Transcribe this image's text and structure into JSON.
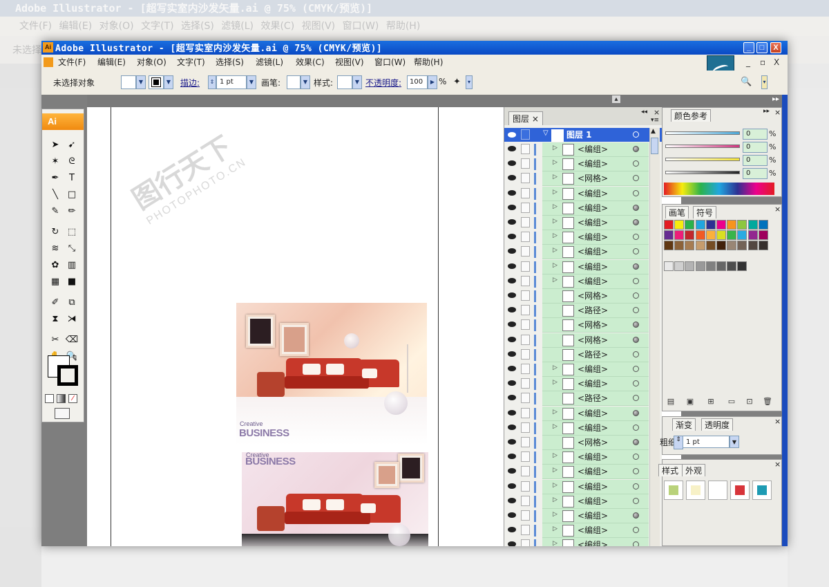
{
  "background_app": {
    "title": "Adobe Illustrator - [超写实室内沙发矢量.ai @ 75% (CMYK/预览)]",
    "menu": [
      "文件(F)",
      "编辑(E)",
      "对象(O)",
      "文字(T)",
      "选择(S)",
      "滤镜(L)",
      "效果(C)",
      "视图(V)",
      "窗口(W)",
      "帮助(H)"
    ],
    "status": "未选择"
  },
  "window": {
    "title": "Adobe Illustrator - [超写实室内沙发矢量.ai @ 75% (CMYK/预览)]",
    "app_icon": "Ai",
    "minimize": "_",
    "maximize": "□",
    "close": "X"
  },
  "menu": {
    "items": [
      "文件(F)",
      "编辑(E)",
      "对象(O)",
      "文字(T)",
      "选择(S)",
      "滤镜(L)",
      "效果(C)",
      "视图(V)",
      "窗口(W)",
      "帮助(H)"
    ],
    "doc_minimize": "_",
    "doc_restore": "▫",
    "doc_close": "X"
  },
  "control_bar": {
    "selection_status": "未选择对象",
    "stroke_label": "描边:",
    "stroke_weight": "1 pt",
    "brush_label": "画笔:",
    "style_label": "样式:",
    "opacity_label": "不透明度:",
    "opacity_value": "100",
    "opacity_unit": "%"
  },
  "toolbox": {
    "logo": "Ai",
    "tools": [
      "selection-tool",
      "direct-selection-tool",
      "magic-wand-tool",
      "lasso-tool",
      "pen-tool",
      "type-tool",
      "line-tool",
      "rectangle-tool",
      "paintbrush-tool",
      "pencil-tool",
      "rotate-tool",
      "scale-tool",
      "warp-tool",
      "free-transform-tool",
      "symbol-sprayer-tool",
      "column-graph-tool",
      "mesh-tool",
      "gradient-tool",
      "eyedropper-tool",
      "blend-tool",
      "live-paint-tool",
      "live-paint-selection-tool",
      "slice-tool",
      "eraser-tool",
      "hand-tool",
      "zoom-tool"
    ],
    "tool_glyphs": [
      "➤",
      "➹",
      "✶",
      "ᘓ",
      "✒",
      "T",
      "╲",
      "□",
      "✎",
      "✏",
      "↻",
      "⬚",
      "≋",
      "⤡",
      "✿",
      "▥",
      "▦",
      "■",
      "✐",
      "⧉",
      "⧗",
      "⧕",
      "✂",
      "⌫",
      "✋",
      "🔍"
    ]
  },
  "artwork": {
    "top": {
      "brand_small": "Creative",
      "brand_big": "BUSINESS"
    },
    "bottom": {
      "brand_small": "Creative",
      "brand_big": "BUSINESS"
    }
  },
  "layers_panel": {
    "tab": "图层",
    "tab_close": "×",
    "layer_name": "图层 1",
    "rows": [
      {
        "name": "<编组>",
        "expand": true,
        "filled": true
      },
      {
        "name": "<编组>",
        "expand": true,
        "filled": false
      },
      {
        "name": "<网格>",
        "expand": true,
        "filled": false
      },
      {
        "name": "<编组>",
        "expand": true,
        "filled": false
      },
      {
        "name": "<编组>",
        "expand": true,
        "filled": true
      },
      {
        "name": "<编组>",
        "expand": true,
        "filled": true
      },
      {
        "name": "<编组>",
        "expand": true,
        "filled": false
      },
      {
        "name": "<编组>",
        "expand": true,
        "filled": false
      },
      {
        "name": "<编组>",
        "expand": true,
        "filled": true
      },
      {
        "name": "<编组>",
        "expand": true,
        "filled": false
      },
      {
        "name": "<网格>",
        "expand": false,
        "filled": false
      },
      {
        "name": "<路径>",
        "expand": false,
        "filled": false
      },
      {
        "name": "<网格>",
        "expand": false,
        "filled": true
      },
      {
        "name": "<网格>",
        "expand": false,
        "filled": true
      },
      {
        "name": "<路径>",
        "expand": false,
        "filled": false
      },
      {
        "name": "<编组>",
        "expand": true,
        "filled": false
      },
      {
        "name": "<编组>",
        "expand": true,
        "filled": false
      },
      {
        "name": "<路径>",
        "expand": false,
        "filled": false
      },
      {
        "name": "<编组>",
        "expand": true,
        "filled": true
      },
      {
        "name": "<编组>",
        "expand": true,
        "filled": false
      },
      {
        "name": "<网格>",
        "expand": false,
        "filled": true
      },
      {
        "name": "<编组>",
        "expand": true,
        "filled": false
      },
      {
        "name": "<编组>",
        "expand": true,
        "filled": false
      },
      {
        "name": "<编组>",
        "expand": true,
        "filled": false
      },
      {
        "name": "<编组>",
        "expand": true,
        "filled": false
      },
      {
        "name": "<编组>",
        "expand": true,
        "filled": true
      },
      {
        "name": "<编组>",
        "expand": true,
        "filled": false
      },
      {
        "name": "<编组>",
        "expand": true,
        "filled": false
      }
    ]
  },
  "color_guide_panel": {
    "tab": "颜色参考",
    "sliders": [
      {
        "value": "0",
        "unit": "%",
        "color": "#4aa7d8"
      },
      {
        "value": "0",
        "unit": "%",
        "color": "#d0357f"
      },
      {
        "value": "0",
        "unit": "%",
        "color": "#f3e33a"
      },
      {
        "value": "0",
        "unit": "%",
        "color": "#222222"
      }
    ]
  },
  "swatch_panel": {
    "tabs": [
      "画笔",
      "符号"
    ],
    "colors": [
      "#e31c23",
      "#f6ec0e",
      "#2bb24c",
      "#21a6df",
      "#2e3192",
      "#ec008c",
      "#f7941d",
      "#8dc63f",
      "#00a99d",
      "#0072bc",
      "#662d91",
      "#ed1e79",
      "#c1272d",
      "#f15a24",
      "#fbb03b",
      "#d9e021",
      "#39b54a",
      "#29abe2",
      "#92278f",
      "#9e005d",
      "#603813",
      "#8c6239",
      "#a67c52",
      "#c69c6d",
      "#754c24",
      "#42210b",
      "#998675",
      "#736357",
      "#534741",
      "#362f2d"
    ]
  },
  "stroke_panel": {
    "tabs": [
      "渐变",
      "透明度"
    ],
    "weight_label": "粗细:",
    "weight_value": "1 pt"
  },
  "appearance_panel": {
    "tabs": [
      "样式",
      "外观"
    ],
    "swatches": [
      "#b9d27a",
      "#f7f1c7",
      "#ffffff",
      "#d7343a",
      "#1e9bb3"
    ]
  },
  "watermark": {
    "text_cn": "图行天下",
    "text_en": "PHOTOPHOTO.CN"
  }
}
